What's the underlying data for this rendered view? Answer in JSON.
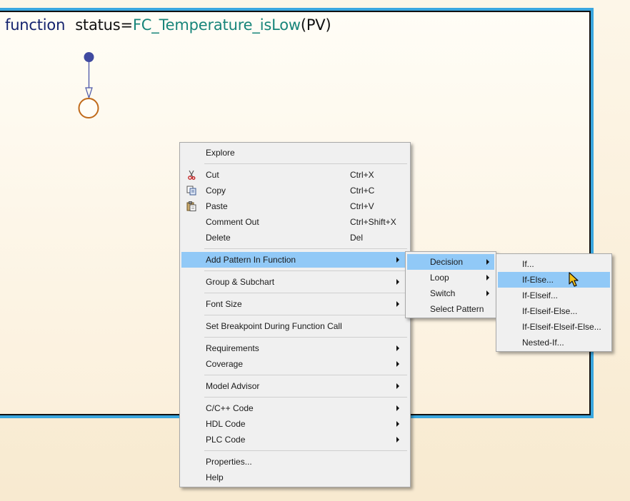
{
  "function_signature": {
    "keyword": "function",
    "output": "status",
    "equals": "=",
    "name": "FC_Temperature_isLow",
    "args": "(PV)"
  },
  "context_menu": {
    "explore": "Explore",
    "cut": "Cut",
    "cut_shortcut": "Ctrl+X",
    "copy": "Copy",
    "copy_shortcut": "Ctrl+C",
    "paste": "Paste",
    "paste_shortcut": "Ctrl+V",
    "comment_out": "Comment Out",
    "comment_out_shortcut": "Ctrl+Shift+X",
    "delete": "Delete",
    "delete_shortcut": "Del",
    "add_pattern": "Add Pattern In Function",
    "group_subchart": "Group & Subchart",
    "font_size": "Font Size",
    "set_breakpoint": "Set Breakpoint During Function Call",
    "requirements": "Requirements",
    "coverage": "Coverage",
    "model_advisor": "Model Advisor",
    "cpp_code": "C/C++ Code",
    "hdl_code": "HDL Code",
    "plc_code": "PLC Code",
    "properties": "Properties...",
    "help": "Help"
  },
  "pattern_submenu": {
    "decision": "Decision",
    "loop": "Loop",
    "switch": "Switch",
    "select_pattern": "Select Pattern"
  },
  "decision_submenu": {
    "if": "If...",
    "if_else": "If-Else...",
    "if_elseif": "If-Elseif...",
    "if_elseif_else": "If-Elseif-Else...",
    "if_elseif_elseif_else": "If-Elseif-Elseif-Else...",
    "nested_if": "Nested-If..."
  },
  "colors": {
    "canvas": "#fbf0da",
    "selection_outline": "#3aa6df",
    "menu_highlight": "#91c9f7",
    "junction": "#c06a1a",
    "default_transition_dot": "#3f4aa0"
  },
  "icons": {
    "cut": "scissors-icon",
    "copy": "copy-icon",
    "paste": "paste-icon",
    "cursor": "mouse-pointer-icon"
  }
}
